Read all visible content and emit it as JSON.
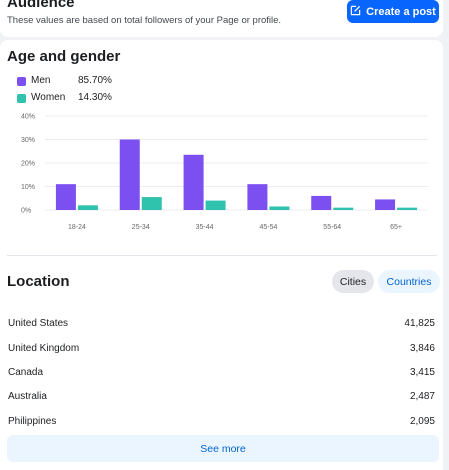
{
  "audience": {
    "title": "Audience",
    "subtitle": "These values are based on total followers of your Page or profile.",
    "create_post_label": "Create a post"
  },
  "age_gender": {
    "title": "Age and gender",
    "legend": [
      {
        "label": "Men",
        "value": "85.70%",
        "color": "#7c4ff0"
      },
      {
        "label": "Women",
        "value": "14.30%",
        "color": "#2fc2ad"
      }
    ]
  },
  "chart_data": {
    "type": "bar",
    "categories": [
      "18-24",
      "25-34",
      "35-44",
      "45-54",
      "55-64",
      "65+"
    ],
    "series": [
      {
        "name": "Men",
        "values": [
          11,
          30,
          23.5,
          11,
          6,
          4.5
        ],
        "color": "#7c4ff0"
      },
      {
        "name": "Women",
        "values": [
          2,
          5.5,
          4,
          1.5,
          1,
          1
        ],
        "color": "#2fc2ad"
      }
    ],
    "y_ticks": [
      "0%",
      "10%",
      "20%",
      "30%",
      "40%"
    ],
    "ylim": [
      0,
      40
    ],
    "grid": true
  },
  "location": {
    "title": "Location",
    "tab_cities": "Cities",
    "tab_countries": "Countries",
    "rows": [
      {
        "name": "United States",
        "value": "41,825"
      },
      {
        "name": "United Kingdom",
        "value": "3,846"
      },
      {
        "name": "Canada",
        "value": "3,415"
      },
      {
        "name": "Australia",
        "value": "2,487"
      },
      {
        "name": "Philippines",
        "value": "2,095"
      }
    ],
    "see_more_label": "See more"
  }
}
